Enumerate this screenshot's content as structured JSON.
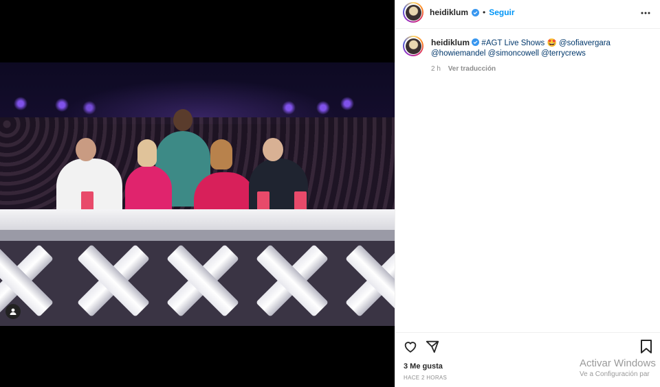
{
  "post": {
    "username": "heidiklum",
    "separator": "•",
    "follow_label": "Seguir",
    "more_icon": "more-horizontal-icon"
  },
  "caption": {
    "username": "heidiklum",
    "hashtag": "#AGT Live Shows",
    "emoji": "🤩",
    "mentions": [
      "@sofiavergara",
      "@howiemandel",
      "@simoncowell",
      "@terrycrews"
    ],
    "age": "2 h",
    "translate_label": "Ver traducción"
  },
  "actions": {
    "like_icon": "heart-icon",
    "share_icon": "send-icon",
    "save_icon": "bookmark-icon"
  },
  "likes_label": "3 Me gusta",
  "time_label": "HACE 2 HORAS",
  "watermark": {
    "title": "Activar Windows",
    "subtitle": "Ve a Configuración par"
  },
  "colors": {
    "follow_blue": "#0095f6",
    "mention_blue": "#00376b",
    "verified_blue": "#3897f0"
  }
}
